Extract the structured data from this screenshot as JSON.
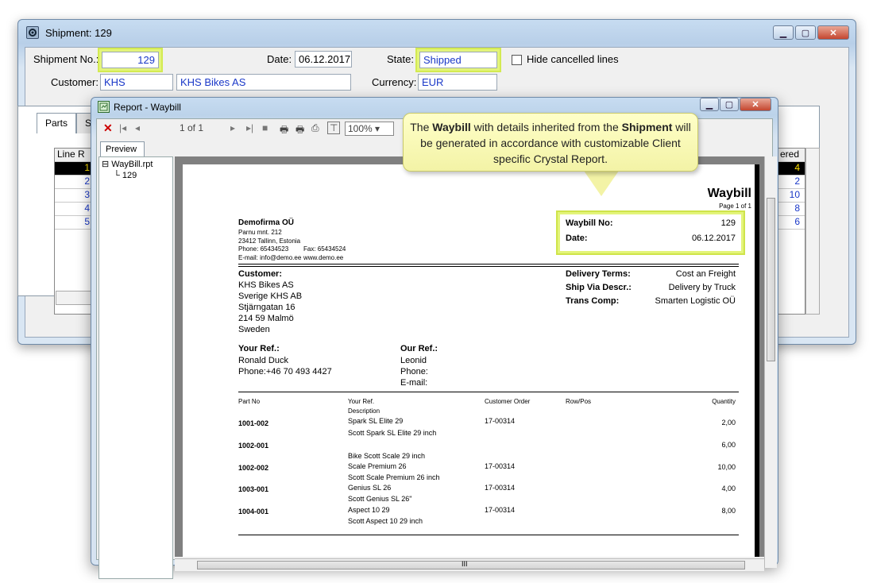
{
  "shipment_window": {
    "title": "Shipment: 129",
    "shipment_no_label": "Shipment No.:",
    "shipment_no": "129",
    "date_label": "Date:",
    "date": "06.12.2017",
    "state_label": "State:",
    "state": "Shipped",
    "hide_cancelled_label": "Hide cancelled lines",
    "customer_label": "Customer:",
    "customer_code": "KHS",
    "customer_name": "KHS Bikes AS",
    "currency_label": "Currency:",
    "currency": "EUR",
    "tabs": [
      "Parts",
      "S"
    ],
    "grid_headers": [
      "Line",
      "R"
    ],
    "lines": [
      "1",
      "2",
      "3",
      "4",
      "5"
    ],
    "right_header": "ered",
    "right_values": [
      "4",
      "2",
      "10",
      "8",
      "6"
    ]
  },
  "report_window": {
    "title": "Report - Waybill",
    "page_indicator": "1 of 1",
    "zoom": "100%",
    "preview_tab": "Preview",
    "tree_root": "WayBill.rpt",
    "tree_child": "129",
    "hscroll_mark": "III"
  },
  "callout": {
    "p1": "The ",
    "b1": "Waybill",
    "p2": " with details inherited from the ",
    "b2": "Shipment",
    "p3": " will be generated in accordance with customizable Client specific Crystal Report."
  },
  "waybill": {
    "title": "Waybill",
    "page": "Page 1 of 1",
    "company": "Demofirma OÜ",
    "addr1": "Parnu mnt. 212",
    "addr2": "23412 Tallinn, Estonia",
    "phone": "Phone: 65434523",
    "fax": "Fax: 65434524",
    "email": "E-mail:  info@demo.ee",
    "web": "www.demo.ee",
    "waybill_no_label": "Waybill No:",
    "waybill_no": "129",
    "date_label": "Date:",
    "date": "06.12.2017",
    "customer_label": "Customer:",
    "customer_lines": [
      "KHS Bikes AS",
      "Sverige KHS AB",
      "Stjärngatan 16",
      "214 59 Malmö",
      "Sweden"
    ],
    "delivery_terms_label": "Delivery Terms:",
    "delivery_terms": "Cost an Freight",
    "ship_via_label": "Ship Via Descr.:",
    "ship_via": "Delivery by Truck",
    "trans_comp_label": "Trans Comp:",
    "trans_comp": "Smarten Logistic OÜ",
    "your_ref_label": "Your Ref.:",
    "your_ref_name": "Ronald Duck",
    "your_ref_phone": "Phone:+46 70 493 4427",
    "our_ref_label": "Our Ref.:",
    "our_ref_name": "Leonid",
    "our_ref_phone": "Phone:",
    "our_ref_email": "E-mail:",
    "col_part": "Part No",
    "col_yourref": "Your Ref.",
    "col_desc": "Description",
    "col_custorder": "Customer Order",
    "col_rowpos": "Row/Pos",
    "col_qty": "Quantity",
    "rows": [
      {
        "part": "1001-002",
        "ref": "Spark SL Elite 29",
        "order": "17-00314",
        "qty": "2,00",
        "desc": "Scott Spark SL Elite 29 inch"
      },
      {
        "part": "1002-001",
        "ref": "",
        "order": "",
        "qty": "6,00",
        "desc": "Bike Scott Scale 29 inch"
      },
      {
        "part": "1002-002",
        "ref": "Scale Premium 26",
        "order": "17-00314",
        "qty": "10,00",
        "desc": "Scott Scale Premium 26 inch"
      },
      {
        "part": "1003-001",
        "ref": "Genius SL 26",
        "order": "17-00314",
        "qty": "4,00",
        "desc": "Scott Genius SL 26\""
      },
      {
        "part": "1004-001",
        "ref": "Aspect 10 29",
        "order": "17-00314",
        "qty": "8,00",
        "desc": "Scott Aspect 10 29 inch"
      }
    ]
  },
  "colors": {
    "highlight": "#e3f47a",
    "field_text": "#1a38c8",
    "callout_bg": "#f8f8b8"
  }
}
